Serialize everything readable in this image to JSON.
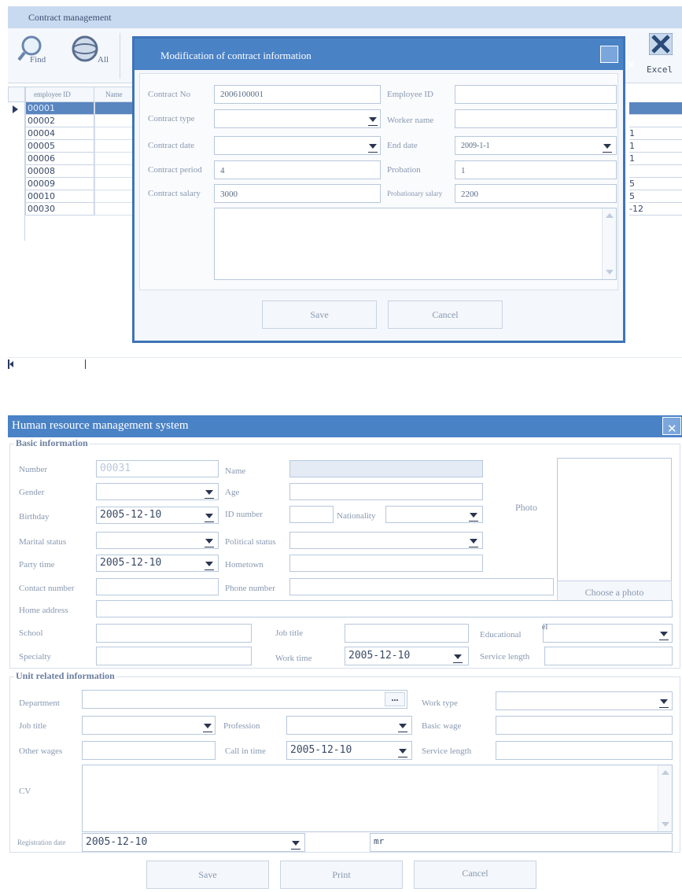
{
  "top_window": {
    "title": "Contract management",
    "toolbar": {
      "find": "Find",
      "all": "All",
      "excel": "Excel"
    },
    "grid": {
      "col_employee_id": "employee ID",
      "col_name": "Name",
      "rows": [
        "00001",
        "00002",
        "00004",
        "00005",
        "00006",
        "00008",
        "00009",
        "00010",
        "00030"
      ],
      "right_col_fragments": [
        "",
        "",
        "1",
        "1",
        "1",
        "",
        "5",
        "5",
        "-12"
      ]
    }
  },
  "dialog": {
    "title": "Modification of contract information",
    "close": "✕",
    "fields": {
      "contract_no_label": "Contract No",
      "contract_no": "2006100001",
      "employee_id_label": "Employee ID",
      "employee_id": "",
      "contract_type_label": "Contract type",
      "contract_type": "",
      "worker_name_label": "Worker name",
      "worker_name": "",
      "contract_date_label": "Contract date",
      "contract_date": "",
      "end_date_label": "End date",
      "end_date": "2009-1-1",
      "contract_period_label": "Contract period",
      "contract_period": "4",
      "probation_label": "Probation",
      "probation": "1",
      "contract_salary_label": "Contract salary",
      "contract_salary": "3000",
      "probationary_salary_label": "Probationary salary",
      "probationary_salary": "2200"
    },
    "save": "Save",
    "cancel": "Cancel"
  },
  "hr_window": {
    "title": "Human resource management system",
    "close": "✕",
    "basic_group": "Basic information",
    "unit_group": "Unit related information",
    "labels": {
      "number": "Number",
      "name": "Name",
      "gender": "Gender",
      "age": "Age",
      "birthday": "Birthday",
      "id_number": "ID number",
      "nationality": "Nationality",
      "marital": "Marital status",
      "political": "Political status",
      "party_time": "Party time",
      "hometown": "Hometown",
      "contact": "Contact number",
      "phone": "Phone number",
      "home_address": "Home address",
      "school": "School",
      "job_title": "Job title",
      "educational": "Educational",
      "specialty": "Specialty",
      "work_time": "Work time",
      "service_length": "Service length",
      "photo": "Photo",
      "choose_photo": "Choose a photo",
      "department": "Department",
      "work_type": "Work type",
      "unit_job_title": "Job title",
      "profession": "Profession",
      "basic_wage": "Basic wage",
      "other_wages": "Other wages",
      "call_in_time": "Call in time",
      "unit_service_length": "Service length",
      "cv": "CV",
      "registration_date": "Registration date"
    },
    "values": {
      "number": "00031",
      "birthday": "2005-12-10",
      "party_time": "2005-12-10",
      "work_time": "2005-12-10",
      "call_in_time": "2005-12-10",
      "registration_date": "2005-12-10",
      "registrar": "mr",
      "educational": "el",
      "department_button": "..."
    },
    "buttons": {
      "save": "Save",
      "print": "Print",
      "cancel": "Cancel"
    }
  }
}
